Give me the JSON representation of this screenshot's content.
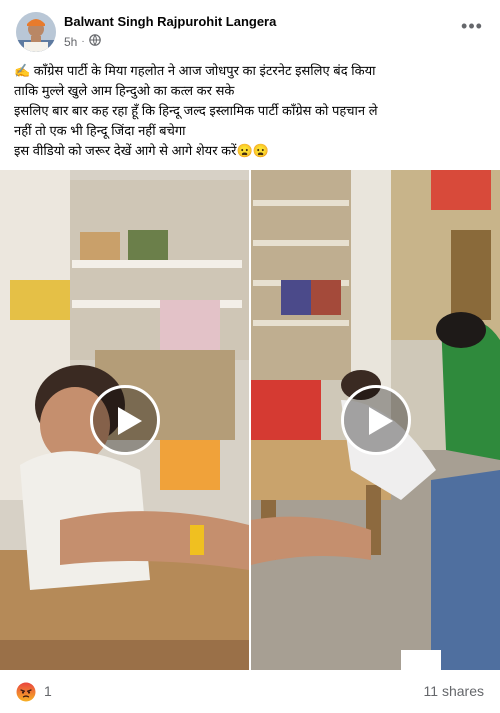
{
  "post": {
    "author": "Balwant Singh Rajpurohit Langera",
    "time": "5h",
    "separator": "·",
    "privacy_icon": "globe-icon",
    "more_label": "•••",
    "text_lines": [
      "✍️ कॉंग्रेस पार्टी के मिया गहलोत ने आज जोधपुर का इंटरनेट इसलिए बंद किया",
      "ताकि मुल्ले खुले आम हिन्दुओ का कत्ल कर सके",
      "इसलिए बार बार कह रहा हूँ कि हिन्दू जल्द इस्लामिक पार्टी कॉंग्रेस को पहचान ले",
      "नहीं तो एक भी हिन्दू जिंदा नहीं बचेगा",
      "इस वीडियो को जरूर देखें आगे से आगे शेयर करें😦😦"
    ]
  },
  "media": {
    "videos": [
      {
        "name": "video-left",
        "play_icon": "play-icon"
      },
      {
        "name": "video-right",
        "play_icon": "play-icon"
      }
    ]
  },
  "footer": {
    "reaction_icon": "angry-reaction-icon",
    "reaction_count": "1",
    "shares": "11 shares"
  },
  "colors": {
    "text": "#050505",
    "secondary": "#65676b",
    "angry": "#f0721e",
    "play_overlay": "#ffffff"
  }
}
